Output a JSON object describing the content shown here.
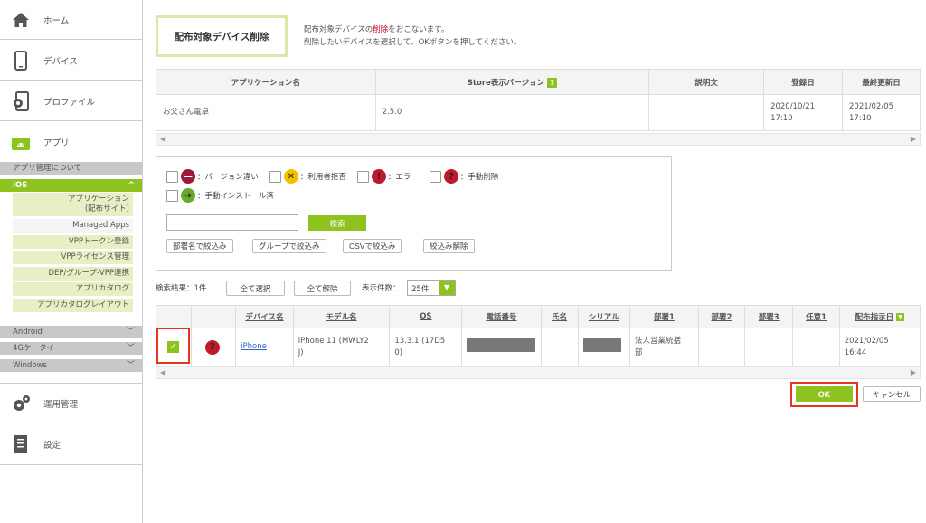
{
  "sidebar": {
    "home": {
      "label": "ホーム",
      "icon": "home-icon"
    },
    "device": {
      "label": "デバイス",
      "icon": "smartphone-icon"
    },
    "profile": {
      "label": "プロファイル",
      "icon": "profile-icon"
    },
    "app": {
      "label": "アプリ",
      "icon": "android-app-icon"
    },
    "about": "アプリ管理について",
    "ios": {
      "label": "iOS",
      "chevron": "^"
    },
    "ios_items": [
      "アプリケーション\n(配布サイト)",
      "Managed Apps",
      "VPPトークン登録",
      "VPPライセンス管理",
      "DEP/グループ-VPP連携",
      "アプリカタログ",
      "アプリカタログレイアウト"
    ],
    "android": "Android",
    "g4": "4Gケータイ",
    "windows": "Windows",
    "chevron_down": "﹀",
    "operation": {
      "label": "運用管理",
      "icon": "gear-icon"
    },
    "settings": {
      "label": "設定",
      "icon": "settings-doc-icon"
    }
  },
  "header": {
    "title": "配布対象デバイス削除",
    "desc_line1_a": "配布対象デバイスの",
    "desc_line1_red": "削除",
    "desc_line1_b": "をおこないます。",
    "desc_line2": "削除したいデバイスを選択して、OKボタンを押してください。"
  },
  "app_table": {
    "headers": [
      "アプリケーション名",
      "Store表示バージョン",
      "説明文",
      "登録日",
      "最終更新日"
    ],
    "help_badge": "?",
    "row": {
      "name": "お父さん電卓",
      "version": "2.5.0",
      "desc": "",
      "registered": "2020/10/21\n17:10",
      "updated": "2021/02/05\n17:10"
    }
  },
  "scroll": {
    "left": "◀",
    "right": "▶"
  },
  "filter": {
    "status": [
      {
        "label": "：バージョン違い",
        "icon": "version-mismatch-icon",
        "color": "#9b1c3a"
      },
      {
        "label": "：利用者拒否",
        "icon": "user-rejected-icon",
        "color": "#f2c200"
      },
      {
        "label": "：エラー",
        "icon": "error-icon",
        "color": "#c0182c"
      },
      {
        "label": "：手動削除",
        "icon": "manual-delete-icon",
        "color": "#c0182c"
      },
      {
        "label": "：手動インストール済",
        "icon": "manual-installed-icon",
        "color": "#6aa830"
      }
    ],
    "icon_glyphs": [
      "—",
      "✕",
      "!",
      "?",
      "➜"
    ],
    "search_value": "",
    "search_btn": "検索",
    "buttons": [
      "部署名で絞込み",
      "グループで絞込み",
      "CSVで絞込み",
      "絞込み解除"
    ]
  },
  "results": {
    "label": "検索結果：1件",
    "select_all": "全て選択",
    "clear_all": "全て解除",
    "count_label": "表示件数：",
    "count_value": "25件",
    "count_dd": "▼"
  },
  "device_table": {
    "headers": [
      "",
      "",
      "デバイス名",
      "モデル名",
      "OS",
      "電話番号",
      "氏名",
      "シリアル",
      "部署1",
      "部署2",
      "部署3",
      "任意1",
      "配布指示日"
    ],
    "sort_glyph": "▼",
    "row": {
      "checked_glyph": "✓",
      "status_glyph": "?",
      "device_name": "iPhone",
      "model": "iPhone 11 (MWLY2\nJ)",
      "os": "13.3.1 (17D5\n0)",
      "phone": "",
      "name": "",
      "serial": "",
      "dept1": "法人営業統括\n部",
      "dept2": "",
      "dept3": "",
      "any1": "",
      "date": "2021/02/05\n16:44"
    }
  },
  "actions": {
    "ok": "OK",
    "cancel": "キャンセル"
  },
  "colors": {
    "accent": "#8dc21f",
    "highlight": "#e8341c",
    "masked": "#777777"
  }
}
